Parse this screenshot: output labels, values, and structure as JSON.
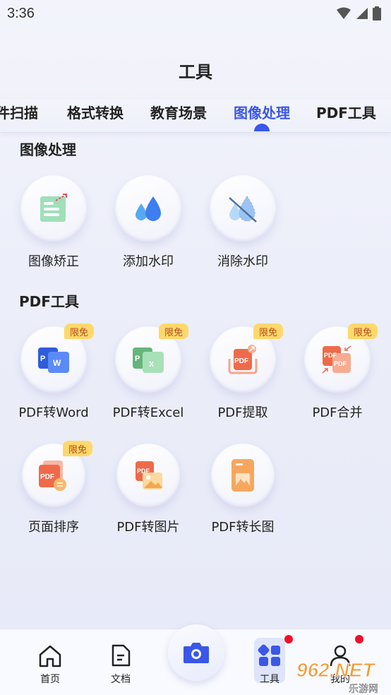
{
  "status": {
    "time": "3:36"
  },
  "header": {
    "title": "工具"
  },
  "tabs": [
    {
      "label": "件扫描"
    },
    {
      "label": "格式转换"
    },
    {
      "label": "教育场景"
    },
    {
      "label": "图像处理",
      "active": true
    },
    {
      "label": "PDF工具"
    }
  ],
  "sections": {
    "image": {
      "title": "图像处理",
      "tools": [
        {
          "label": "图像矫正",
          "icon": "image-correction-icon"
        },
        {
          "label": "添加水印",
          "icon": "add-watermark-icon"
        },
        {
          "label": "消除水印",
          "icon": "remove-watermark-icon"
        }
      ]
    },
    "pdf": {
      "title": "PDF工具",
      "badge": "限免",
      "tools": [
        {
          "label": "PDF转Word",
          "icon": "pdf-to-word-icon",
          "badge": true
        },
        {
          "label": "PDF转Excel",
          "icon": "pdf-to-excel-icon",
          "badge": true
        },
        {
          "label": "PDF提取",
          "icon": "pdf-extract-icon",
          "badge": true
        },
        {
          "label": "PDF合并",
          "icon": "pdf-merge-icon",
          "badge": true
        },
        {
          "label": "页面排序",
          "icon": "page-sort-icon",
          "badge": true
        },
        {
          "label": "PDF转图片",
          "icon": "pdf-to-image-icon",
          "badge": false
        },
        {
          "label": "PDF转长图",
          "icon": "pdf-to-long-image-icon",
          "badge": false
        }
      ]
    }
  },
  "nav": {
    "home": "首页",
    "docs": "文档",
    "tools": "工具",
    "profile": "我的"
  },
  "watermark": {
    "text": "962.NET",
    "subtext": "乐游网"
  },
  "colors": {
    "accent": "#3a57e8",
    "badge": "#ffd86b",
    "notification": "#f0102a"
  }
}
